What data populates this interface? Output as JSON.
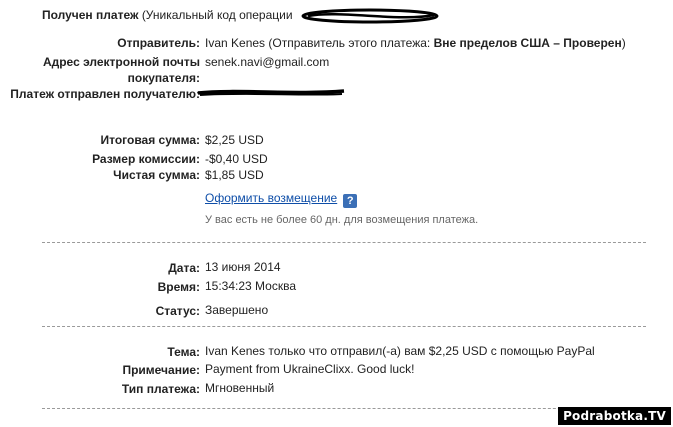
{
  "header": {
    "title": "Получен платеж",
    "subtitle": "(Уникальный код операции"
  },
  "sender": {
    "label": "Отправитель:",
    "name": "Ivan Kenes",
    "note_prefix": "(Отправитель этого платежа:",
    "note_bold": "Вне пределов США – Проверен",
    "note_suffix": ")"
  },
  "buyer_email": {
    "label": "Адрес электронной почты покупателя:",
    "value": "senek.navi@gmail.com"
  },
  "recipient": {
    "label": "Платеж отправлен получателю:"
  },
  "amounts": {
    "total_label": "Итоговая сумма:",
    "total_value": "$2,25 USD",
    "fee_label": "Размер комиссии:",
    "fee_value": "-$0,40 USD",
    "net_label": "Чистая сумма:",
    "net_value": "$1,85 USD"
  },
  "refund": {
    "link_label": "Оформить возмещение",
    "help_icon": "?",
    "note": "У вас есть не более 60 дн. для возмещения платежа."
  },
  "details": {
    "date_label": "Дата:",
    "date_value": "13 июня 2014",
    "time_label": "Время:",
    "time_value": "15:34:23 Москва",
    "status_label": "Статус:",
    "status_value": "Завершено"
  },
  "message": {
    "subject_label": "Тема:",
    "subject_value": "Ivan Kenes только что отправил(-а) вам $2,25 USD с помощью PayPal",
    "note_label": "Примечание:",
    "note_value": "Payment from UkraineClixx. Good luck!",
    "type_label": "Тип платежа:",
    "type_value": "Мгновенный"
  },
  "watermark": "Podrabotka.TV",
  "colors": {
    "link": "#0e4ea8",
    "help_icon_bg": "#3b6fb6",
    "note_text": "#666666",
    "divider": "#9a9a9a"
  }
}
